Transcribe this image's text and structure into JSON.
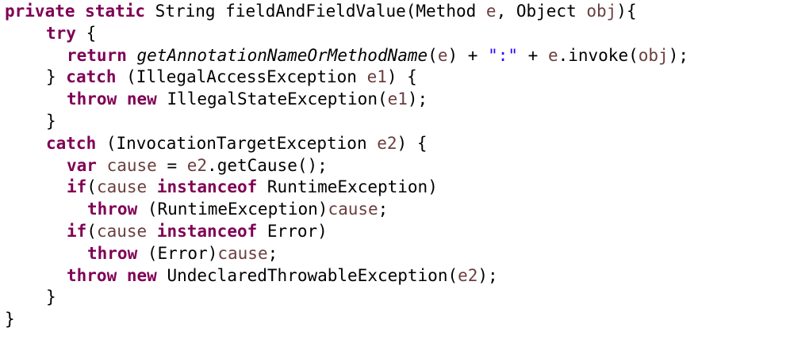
{
  "editor": {
    "background": "#ffffff",
    "colors": {
      "keyword": "#7f0055",
      "local_variable": "#6a3e3e",
      "string": "#2a00ff",
      "default": "#000000"
    },
    "lines": [
      {
        "indent": 0,
        "tokens": [
          {
            "t": "private",
            "k": "kw"
          },
          {
            "t": " "
          },
          {
            "t": "static",
            "k": "kw"
          },
          {
            "t": " String fieldAndFieldValue(Method "
          },
          {
            "t": "e",
            "k": "var"
          },
          {
            "t": ", Object "
          },
          {
            "t": "obj",
            "k": "var"
          },
          {
            "t": "){"
          }
        ]
      },
      {
        "indent": 8,
        "tokens": [
          {
            "t": "try",
            "k": "kw"
          },
          {
            "t": " {"
          }
        ]
      },
      {
        "indent": 12,
        "tokens": [
          {
            "t": "return",
            "k": "kw"
          },
          {
            "t": " "
          },
          {
            "t": "getAnnotationNameOrMethodName",
            "k": "it"
          },
          {
            "t": "("
          },
          {
            "t": "e",
            "k": "var"
          },
          {
            "t": ") + "
          },
          {
            "t": "\":\"",
            "k": "str"
          },
          {
            "t": " + "
          },
          {
            "t": "e",
            "k": "var"
          },
          {
            "t": ".invoke("
          },
          {
            "t": "obj",
            "k": "var"
          },
          {
            "t": ");"
          }
        ]
      },
      {
        "indent": 8,
        "tokens": [
          {
            "t": "} "
          },
          {
            "t": "catch",
            "k": "kw"
          },
          {
            "t": " (IllegalAccessException "
          },
          {
            "t": "e1",
            "k": "var"
          },
          {
            "t": ") {"
          }
        ]
      },
      {
        "indent": 12,
        "tokens": [
          {
            "t": "throw",
            "k": "kw"
          },
          {
            "t": " "
          },
          {
            "t": "new",
            "k": "kw"
          },
          {
            "t": " IllegalStateException("
          },
          {
            "t": "e1",
            "k": "var"
          },
          {
            "t": ");"
          }
        ]
      },
      {
        "indent": 8,
        "tokens": [
          {
            "t": "}"
          }
        ]
      },
      {
        "indent": 8,
        "tokens": [
          {
            "t": "catch",
            "k": "kw"
          },
          {
            "t": " (InvocationTargetException "
          },
          {
            "t": "e2",
            "k": "var"
          },
          {
            "t": ") {"
          }
        ]
      },
      {
        "indent": 12,
        "tokens": [
          {
            "t": "var",
            "k": "kw"
          },
          {
            "t": " "
          },
          {
            "t": "cause",
            "k": "var"
          },
          {
            "t": " = "
          },
          {
            "t": "e2",
            "k": "var"
          },
          {
            "t": ".getCause();"
          }
        ]
      },
      {
        "indent": 12,
        "tokens": [
          {
            "t": "if",
            "k": "kw"
          },
          {
            "t": "("
          },
          {
            "t": "cause",
            "k": "var"
          },
          {
            "t": " "
          },
          {
            "t": "instanceof",
            "k": "kw"
          },
          {
            "t": " RuntimeException)"
          }
        ]
      },
      {
        "indent": 16,
        "tokens": [
          {
            "t": "throw",
            "k": "kw"
          },
          {
            "t": " (RuntimeException)"
          },
          {
            "t": "cause",
            "k": "var"
          },
          {
            "t": ";"
          }
        ]
      },
      {
        "indent": 12,
        "tokens": [
          {
            "t": "if",
            "k": "kw"
          },
          {
            "t": "("
          },
          {
            "t": "cause",
            "k": "var"
          },
          {
            "t": " "
          },
          {
            "t": "instanceof",
            "k": "kw"
          },
          {
            "t": " Error)"
          }
        ]
      },
      {
        "indent": 16,
        "tokens": [
          {
            "t": "throw",
            "k": "kw"
          },
          {
            "t": " (Error)"
          },
          {
            "t": "cause",
            "k": "var"
          },
          {
            "t": ";"
          }
        ]
      },
      {
        "indent": 12,
        "tokens": [
          {
            "t": "throw",
            "k": "kw"
          },
          {
            "t": " "
          },
          {
            "t": "new",
            "k": "kw"
          },
          {
            "t": " UndeclaredThrowableException("
          },
          {
            "t": "e2",
            "k": "var"
          },
          {
            "t": ");"
          }
        ]
      },
      {
        "indent": 8,
        "tokens": [
          {
            "t": "}"
          }
        ]
      },
      {
        "indent": 0,
        "tokens": [
          {
            "t": "}"
          }
        ]
      }
    ]
  }
}
